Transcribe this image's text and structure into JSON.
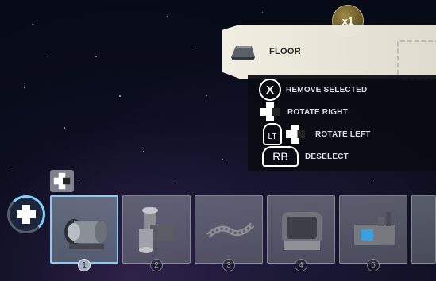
{
  "quantity_badge": "x1",
  "selected_part": {
    "name": "FLOOR"
  },
  "controls": [
    {
      "button": "X",
      "label": "REMOVE SELECTED"
    },
    {
      "button": "dpad-right",
      "label": "ROTATE RIGHT"
    },
    {
      "button": "LT",
      "label": "ROTATE LEFT"
    },
    {
      "button": "RB",
      "label": "DESELECT"
    }
  ],
  "hotbar": {
    "selected_index": 1,
    "slots": [
      {
        "number": "1",
        "icon": "generator-part-icon"
      },
      {
        "number": "2",
        "icon": "pipe-junction-part-icon"
      },
      {
        "number": "3",
        "icon": "cable-part-icon"
      },
      {
        "number": "4",
        "icon": "machine-module-part-icon"
      },
      {
        "number": "5",
        "icon": "turret-module-part-icon"
      }
    ]
  },
  "colors": {
    "accent": "#8ec9f0",
    "panel_light": "#f4f0e4",
    "panel_dark": "#0a0c12",
    "badge_gold": "#8a7638"
  }
}
